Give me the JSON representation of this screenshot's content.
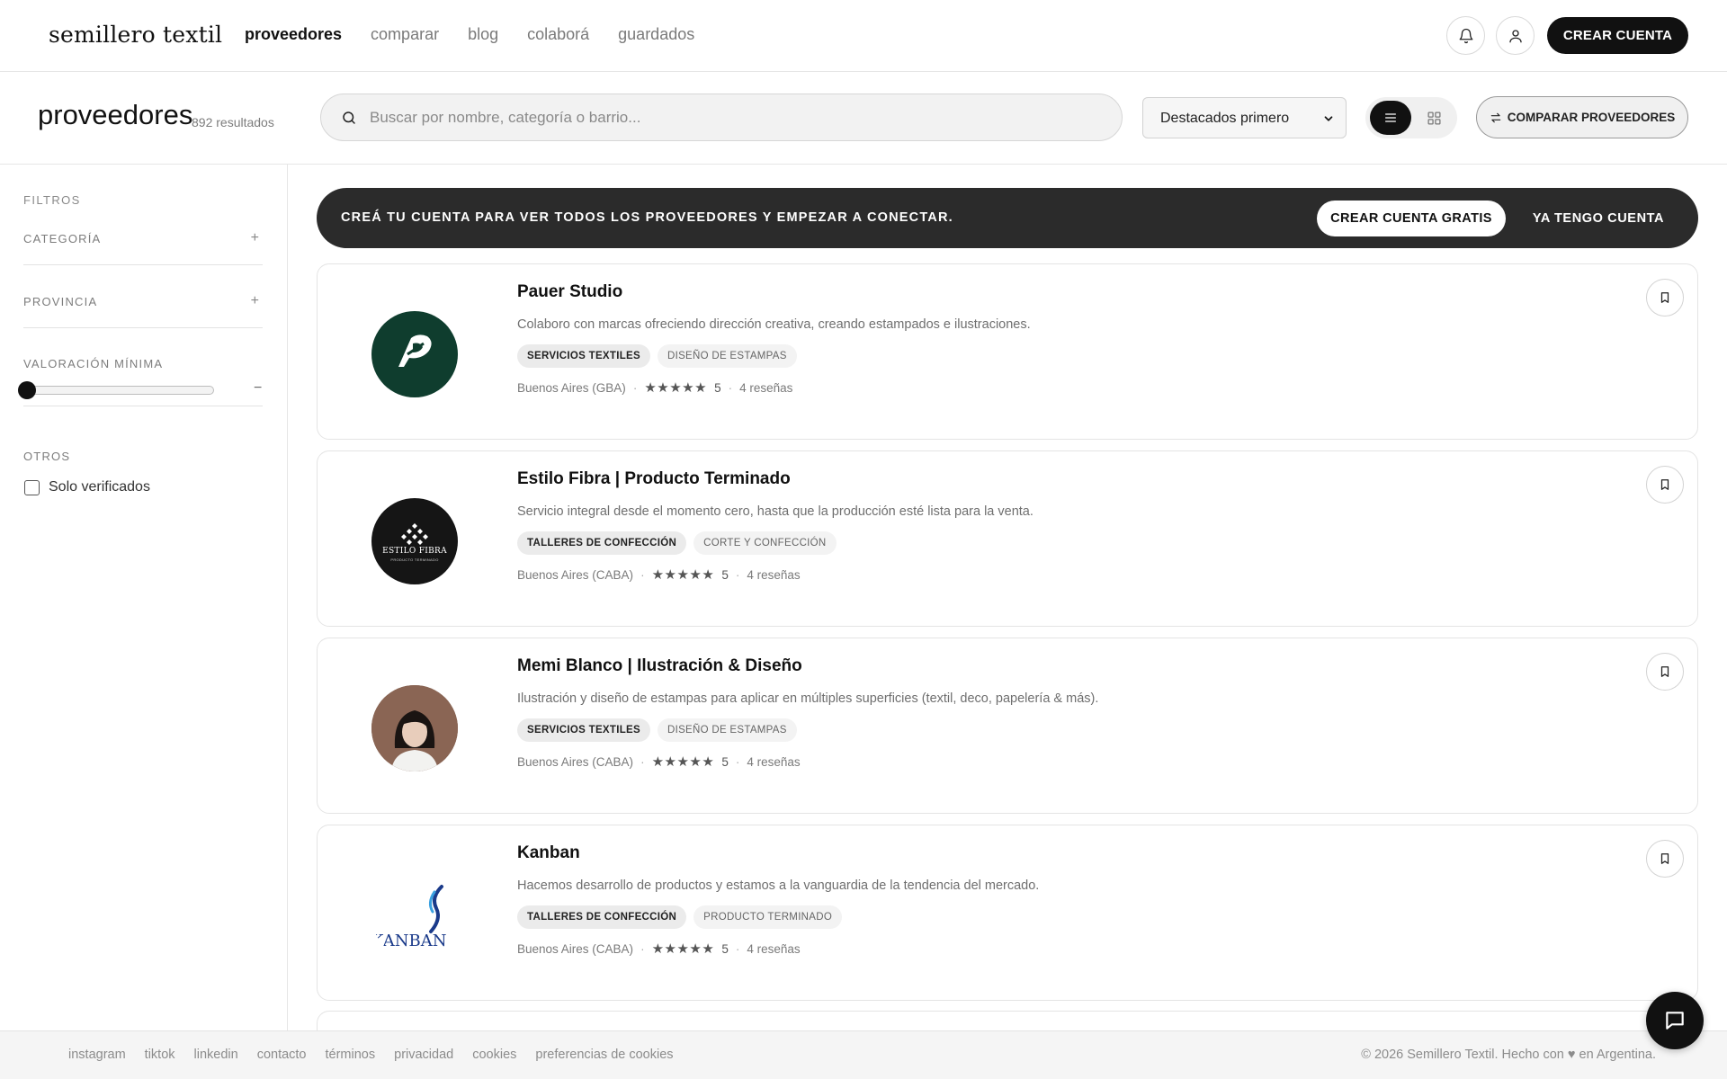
{
  "nav": {
    "logo": "semillero textil",
    "links": [
      "proveedores",
      "comparar",
      "blog",
      "colaborá",
      "guardados"
    ],
    "cta": "CREAR CUENTA"
  },
  "header": {
    "title": "proveedores",
    "count": "892 resultados",
    "search_placeholder": "Buscar por nombre, categoría o barrio...",
    "sort_value": "Destacados primero",
    "compare_label": "COMPARAR PROVEEDORES"
  },
  "filters": {
    "title": "FILTROS",
    "category": "CATEGORÍA",
    "province": "PROVINCIA",
    "rating": "VALORACIÓN MÍNIMA",
    "rating_min_value": 0,
    "others": "OTROS",
    "verified": "Solo verificados"
  },
  "banner": {
    "text": "CREÁ TU CUENTA PARA VER TODOS LOS PROVEEDORES Y EMPEZAR A CONECTAR.",
    "primary": "CREAR CUENTA GRATIS",
    "secondary": "YA TENGO CUENTA"
  },
  "providers": [
    {
      "name": "Pauer Studio",
      "description": "Colaboro con marcas ofreciendo dirección creativa, creando estampados e ilustraciones.",
      "tags": [
        "SERVICIOS TEXTILES",
        "DISEÑO DE ESTAMPAS"
      ],
      "location": "Buenos Aires (GBA)",
      "stars": "★★★★★",
      "rating": "5",
      "reviews": "4 reseñas"
    },
    {
      "name": "Estilo Fibra | Producto Terminado",
      "description": "Servicio integral desde el momento cero, hasta que la producción esté lista para la venta.",
      "tags": [
        "TALLERES DE CONFECCIÓN",
        "CORTE Y CONFECCIÓN"
      ],
      "location": "Buenos Aires (CABA)",
      "stars": "★★★★★",
      "rating": "5",
      "reviews": "4 reseñas",
      "logo_text": "ESTILO FIBRA",
      "logo_sub": "PRODUCTO TERMINADO"
    },
    {
      "name": "Memi Blanco | Ilustración & Diseño",
      "description": "Ilustración y diseño de estampas para aplicar en múltiples superficies (textil, deco, papelería & más).",
      "tags": [
        "SERVICIOS TEXTILES",
        "DISEÑO DE ESTAMPAS"
      ],
      "location": "Buenos Aires (CABA)",
      "stars": "★★★★★",
      "rating": "5",
      "reviews": "4 reseñas"
    },
    {
      "name": "Kanban",
      "description": "Hacemos desarrollo de productos y estamos a la vanguardia de la tendencia del mercado.",
      "tags": [
        "TALLERES DE CONFECCIÓN",
        "PRODUCTO TERMINADO"
      ],
      "location": "Buenos Aires (CABA)",
      "stars": "★★★★★",
      "rating": "5",
      "reviews": "4 reseñas",
      "logo_text": "KANBAN"
    }
  ],
  "footer": {
    "links": [
      "instagram",
      "tiktok",
      "linkedin",
      "contacto",
      "términos",
      "privacidad",
      "cookies",
      "preferencias de cookies"
    ],
    "copyright": "© 2026 Semillero Textil. Hecho con ♥ en Argentina."
  },
  "icons": {
    "bell": "bell-icon",
    "user": "user-icon",
    "search": "search-icon",
    "chevron": "chevron-down-icon",
    "list": "list-view-icon",
    "grid": "grid-view-icon",
    "compare": "arrows-exchange-icon",
    "bookmark": "bookmark-icon",
    "chat": "chat-icon",
    "plus": "plus-icon",
    "minus": "minus-icon"
  },
  "colors": {
    "primary": "#111111",
    "banner": "#2b2b2b",
    "pauer_logo_bg": "#0f3d2e"
  }
}
